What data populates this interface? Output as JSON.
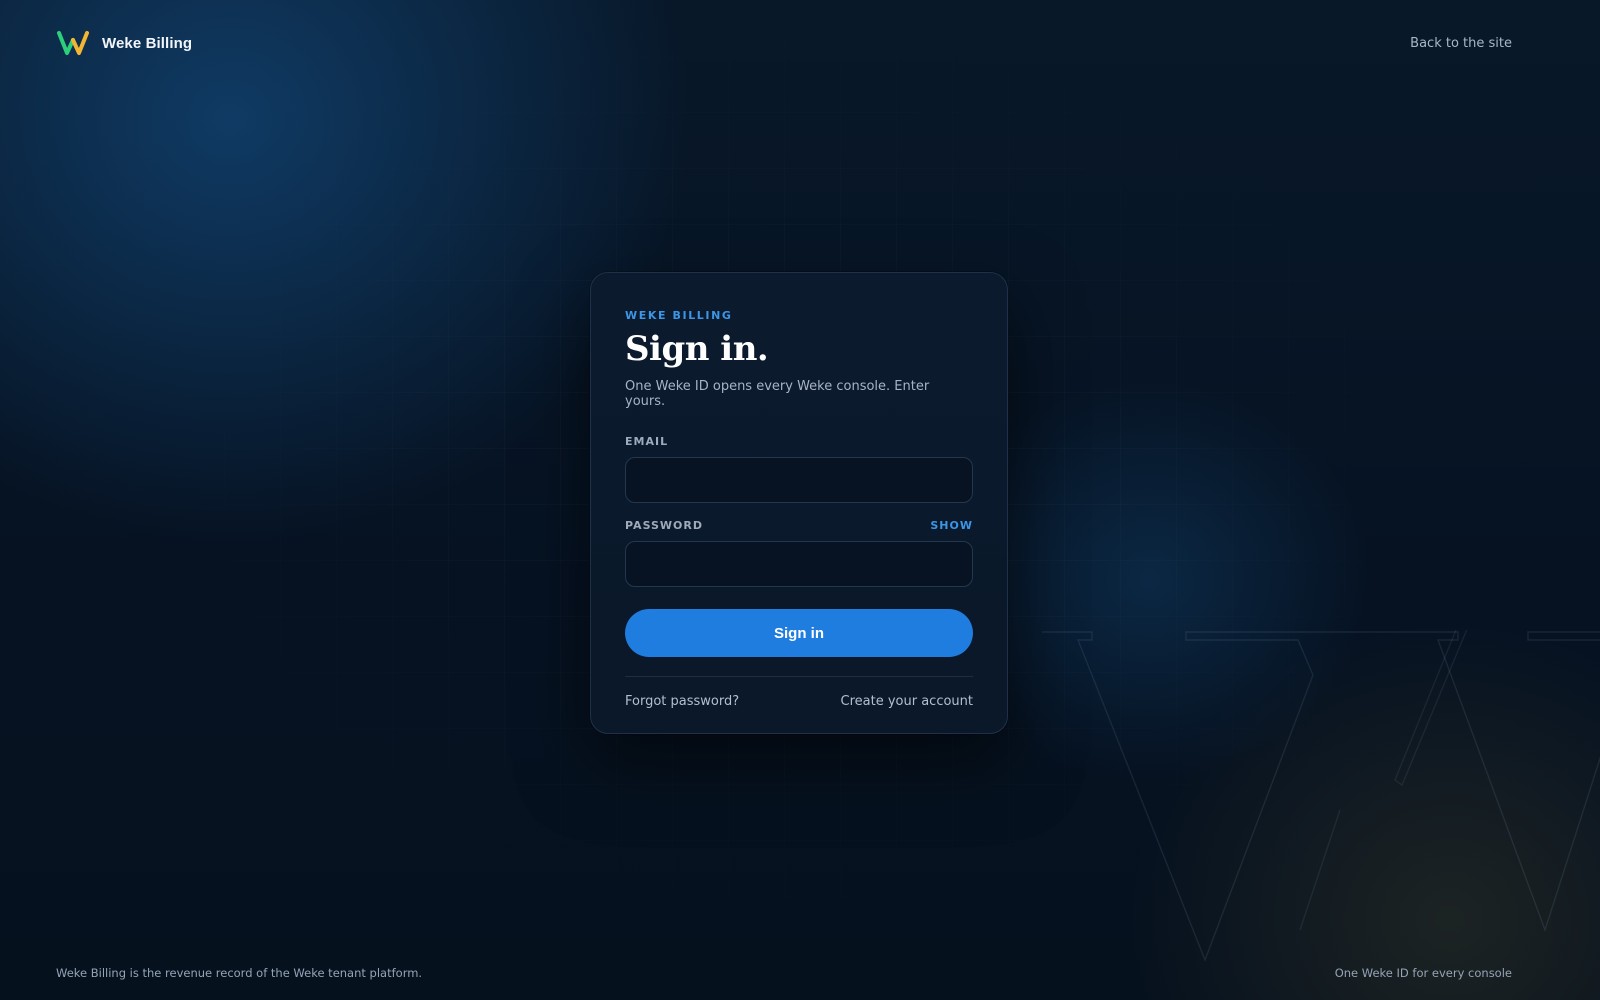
{
  "header": {
    "brand_name": "Weke Billing",
    "logo_icon": "weke-w-logo",
    "back_link": "Back to the site"
  },
  "card": {
    "eyebrow": "WEKE BILLING",
    "title": "Sign in.",
    "subtitle": "One Weke ID opens every Weke console. Enter yours.",
    "email": {
      "label": "EMAIL",
      "value": "",
      "placeholder": ""
    },
    "password": {
      "label": "PASSWORD",
      "toggle_label": "SHOW",
      "value": "",
      "placeholder": ""
    },
    "submit_label": "Sign in",
    "forgot_link": "Forgot password?",
    "create_link": "Create your account"
  },
  "footer": {
    "left_text": "Weke Billing is the revenue record of the Weke tenant platform.",
    "right_text": "One Weke ID for every console"
  },
  "colors": {
    "accent": "#1f7de0",
    "accent_text": "#3d95e6",
    "logo_green": "#2ecf7c",
    "logo_yellow": "#f2b632",
    "background": "#06111f"
  }
}
